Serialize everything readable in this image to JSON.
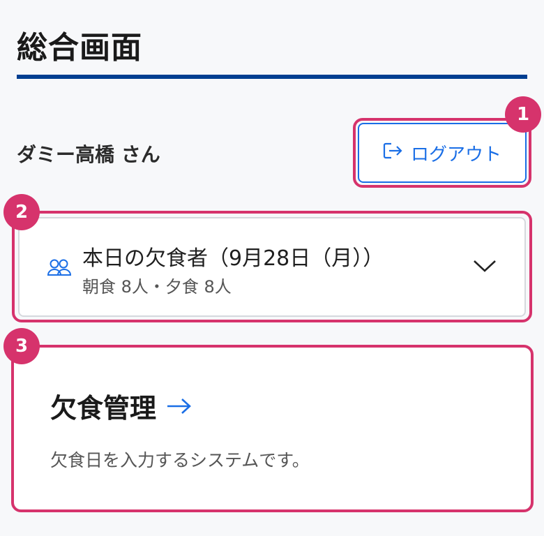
{
  "page": {
    "title": "総合画面"
  },
  "user": {
    "name": "ダミー高橋 さん"
  },
  "logout": {
    "label": "ログアウト",
    "icon": "logout-icon"
  },
  "absentees": {
    "title": "本日の欠食者（9月28日（月））",
    "summary": "朝食 8人・夕食 8人",
    "icon": "users-icon",
    "toggle_icon": "chevron-down-icon"
  },
  "manage": {
    "title": "欠食管理",
    "description": "欠食日を入力するシステムです。",
    "icon": "arrow-right-icon"
  },
  "annotations": [
    "1",
    "2",
    "3"
  ],
  "colors": {
    "accent": "#1a6ee6",
    "rule": "#003f91",
    "highlight": "#d6336c"
  }
}
